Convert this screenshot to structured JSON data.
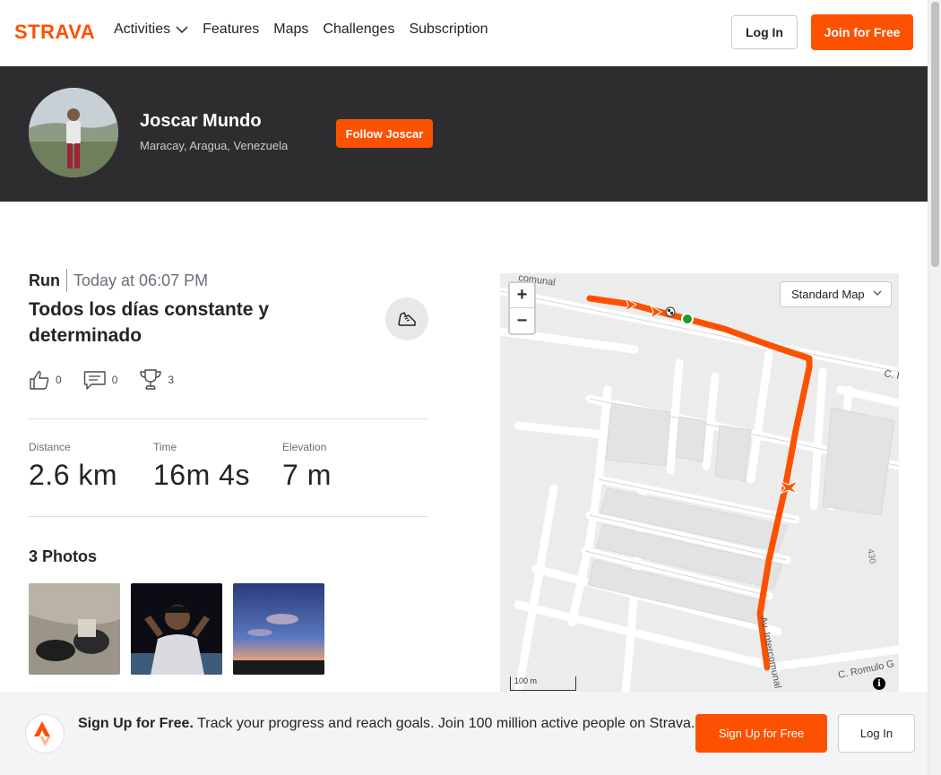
{
  "brand": {
    "logo_text": "STRAVA",
    "accent": "#fc5200"
  },
  "nav": {
    "items": [
      {
        "label": "Activities",
        "has_dropdown": true
      },
      {
        "label": "Features"
      },
      {
        "label": "Maps"
      },
      {
        "label": "Challenges"
      },
      {
        "label": "Subscription"
      }
    ],
    "login_label": "Log In",
    "join_label": "Join for Free"
  },
  "athlete": {
    "name": "Joscar Mundo",
    "location": "Maracay, Aragua, Venezuela",
    "follow_label": "Follow Joscar"
  },
  "activity": {
    "type": "Run",
    "time": "Today at 06:07 PM",
    "title": "Todos los días constante y determinado",
    "sport_icon": "running-shoe-icon",
    "kudos": "0",
    "comments": "0",
    "achievements": "3",
    "stats": [
      {
        "label": "Distance",
        "value": "2.6 km"
      },
      {
        "label": "Time",
        "value": "16m 4s"
      },
      {
        "label": "Elevation",
        "value": "7 m"
      }
    ],
    "photos_title": "3 Photos"
  },
  "map": {
    "style_select": "Standard Map",
    "scale_label": "100 m",
    "street_labels": [
      "Av. Intercomunal",
      "C. Romulo G",
      "C. I",
      "430",
      "comunal"
    ],
    "info_icon": "i"
  },
  "signup": {
    "bold_text": "Sign Up for Free.",
    "text": " Track your progress and reach goals. Join 100 million active people on Strava.",
    "signup_label": "Sign Up for Free",
    "login_label": "Log In"
  }
}
